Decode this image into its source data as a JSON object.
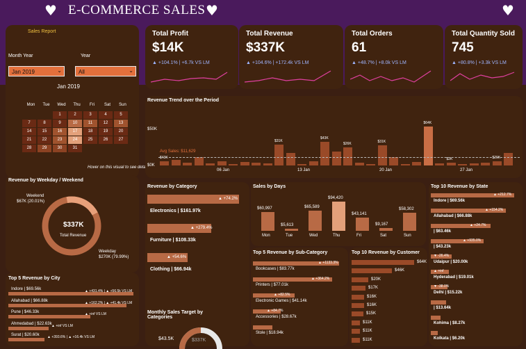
{
  "header": {
    "title": "E-COMMERCE SALES"
  },
  "sales_report": {
    "label": "Sales Report",
    "month_year_label": "Month Year",
    "year_label": "Year",
    "month_year_value": "Jan 2019",
    "year_value": "All"
  },
  "calendar": {
    "title": "Jan 2019",
    "days": [
      "Mon",
      "Tue",
      "Wed",
      "Thu",
      "Fri",
      "Sat",
      "Sun"
    ],
    "weeks": [
      [
        "",
        "",
        "1",
        "2",
        "3",
        "4",
        "5",
        "6"
      ],
      [
        "7",
        "8",
        "9",
        "10",
        "11",
        "12",
        "13"
      ],
      [
        "14",
        "15",
        "16",
        "17",
        "18",
        "19",
        "20"
      ],
      [
        "21",
        "22",
        "23",
        "24",
        "25",
        "26",
        "27"
      ],
      [
        "28",
        "29",
        "30",
        "31",
        "",
        "",
        ""
      ]
    ],
    "hint": "Hover on this visual to see details"
  },
  "kpis": [
    {
      "label": "Total Profit",
      "value": "$14K",
      "change": "▲ +104.1% | +6.7k VS LM"
    },
    {
      "label": "Total Revenue",
      "value": "$337K",
      "change": "▲ +104.6% | +172.4k VS LM"
    },
    {
      "label": "Total Orders",
      "value": "61",
      "change": "▲ +48.7% | +8.0k VS LM"
    },
    {
      "label": "Total Quantity Sold",
      "value": "745",
      "change": "▲ +80.8% | +3.3k VS LM"
    }
  ],
  "trend": {
    "title": "Revenue Trend over the Period",
    "avg_label": "Avg Sales: $11,629",
    "ticks": [
      "$50K",
      "$0K"
    ],
    "x_labels": [
      "06 Jan",
      "13 Jan",
      "20 Jan",
      "27 Jan"
    ],
    "labels": [
      "$0K",
      "$31K",
      "$43K",
      "$26K",
      "$31K",
      "$64K",
      "$2K",
      "$0K",
      "$20K",
      "$0K",
      "$0K",
      "$0K",
      "$0K"
    ]
  },
  "weekday": {
    "title": "Revenue by Weekday / Weekend",
    "center_value": "$337K",
    "center_label": "Total Revenue",
    "weekend_label": "Weekend",
    "weekend_value": "$67K (20.01%)",
    "weekday_label": "Weekday",
    "weekday_value": "$270K (79.99%)"
  },
  "category": {
    "title": "Revenue by Category",
    "items": [
      {
        "label": "Electronics | $161.97k",
        "badge": "▲ +74.2%"
      },
      {
        "label": "Furniture | $108.33k",
        "badge": "▲ +279.4%"
      },
      {
        "label": "Clothing | $66.94k",
        "badge": "▲ +54.6%"
      }
    ]
  },
  "days": {
    "title": "Sales by Days",
    "items": [
      {
        "day": "Mon",
        "value": "$60,997"
      },
      {
        "day": "Tue",
        "value": "$5,613"
      },
      {
        "day": "Wed",
        "value": "$65,589"
      },
      {
        "day": "Thu",
        "value": "$94,420"
      },
      {
        "day": "Fri",
        "value": "$43,141"
      },
      {
        "day": "Sat",
        "value": "$9,167"
      },
      {
        "day": "Sun",
        "value": "$58,302"
      }
    ]
  },
  "state": {
    "title": "Top 10 Revenue by State",
    "items": [
      {
        "label": "Indore | $69.56k",
        "badge": "▲ +212.7%"
      },
      {
        "label": "Allahabad | $66.88k",
        "badge": "▲ +154.2%"
      },
      {
        "label": "| $63.46k",
        "badge": "▲ +24.7%"
      },
      {
        "label": "| $43.23k",
        "badge": "▲ +935.0%"
      },
      {
        "label": "Udaipur | $20.00k",
        "badge": "▼ -26.4%"
      },
      {
        "label": "Hyderabad | $19.01k",
        "badge": "▲ +inf"
      },
      {
        "label": "Delhi | $15.22k",
        "badge": "▼ -38.0%"
      },
      {
        "label": "| $13.64k",
        "badge": ""
      },
      {
        "label": "Kohima | $8.27k",
        "badge": ""
      },
      {
        "label": "Kolkata | $6.20k",
        "badge": ""
      }
    ]
  },
  "city": {
    "title": "Top 5 Revenue by City",
    "items": [
      {
        "label": "Indore | $69.56k",
        "badge": "▲ +431.4% | ▲ +56.5k VS LM"
      },
      {
        "label": "Allahabad | $66.88k",
        "badge": "▲ +162.2% | ▲ +41.4k VS LM"
      },
      {
        "label": "Pune | $46.33k",
        "badge": "▲ +inf VS LM"
      },
      {
        "label": "Ahmedabad | $22.63k",
        "badge": "▲ +inf VS LM"
      },
      {
        "label": "Surat | $20.60k",
        "badge": "▲ +393.6% | ▲ +16.4k VS LM"
      }
    ]
  },
  "subcat": {
    "title": "Top 5 Revenue by Sub-Category",
    "items": [
      {
        "label": "Bookcases | $83.77k",
        "badge": "▲ +1133.3%"
      },
      {
        "label": "Printers | $77.01k",
        "badge": "▲ +364.2%"
      },
      {
        "label": "Electronic Games | $41.14k",
        "badge": "▲ +82.5%"
      },
      {
        "label": "Accessories | $28.67k",
        "badge": "▲ +84.7%"
      },
      {
        "label": "Stole | $18.94k",
        "badge": ""
      }
    ]
  },
  "customer": {
    "title": "Top 10 Revenue by Customer",
    "values": [
      "$64K",
      "$46K",
      "$20K",
      "$17K",
      "$16K",
      "$16K",
      "$15K",
      "$11K",
      "$11K",
      "$11K"
    ]
  },
  "target": {
    "title": "Monthly Sales Target by Categories",
    "left_value": "$43.5K",
    "center_value": "$337K"
  }
}
